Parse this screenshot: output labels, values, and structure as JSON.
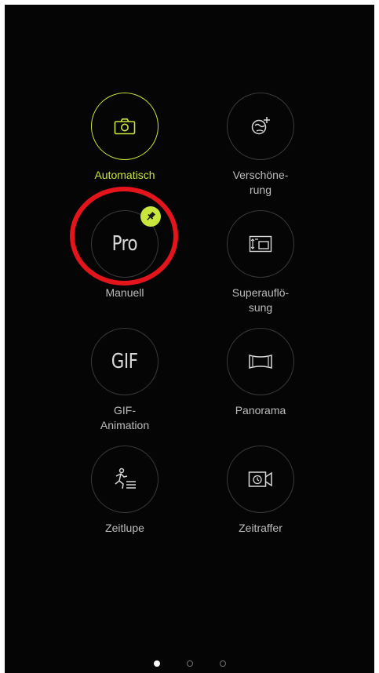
{
  "modes": [
    {
      "label": "Automatisch",
      "icon": "camera-icon",
      "active": true
    },
    {
      "label": "Verschöne-\nrung",
      "icon": "beautify-icon"
    },
    {
      "label": "Manuell",
      "icon_text": "Pro",
      "icon": "pro-mode-icon",
      "pinned": true
    },
    {
      "label": "Superauflö-\nsung",
      "icon": "super-resolution-icon"
    },
    {
      "label": "GIF-\nAnimation",
      "icon_text": "GIF",
      "icon": "gif-icon"
    },
    {
      "label": "Panorama",
      "icon": "panorama-icon"
    },
    {
      "label": "Zeitlupe",
      "icon": "slow-motion-icon"
    },
    {
      "label": "Zeitraffer",
      "icon": "time-lapse-icon"
    }
  ],
  "pagination": {
    "pages": 3,
    "current": 1
  },
  "colors": {
    "accent": "#c8e63b",
    "highlight": "#e4141b",
    "background": "#050505"
  }
}
